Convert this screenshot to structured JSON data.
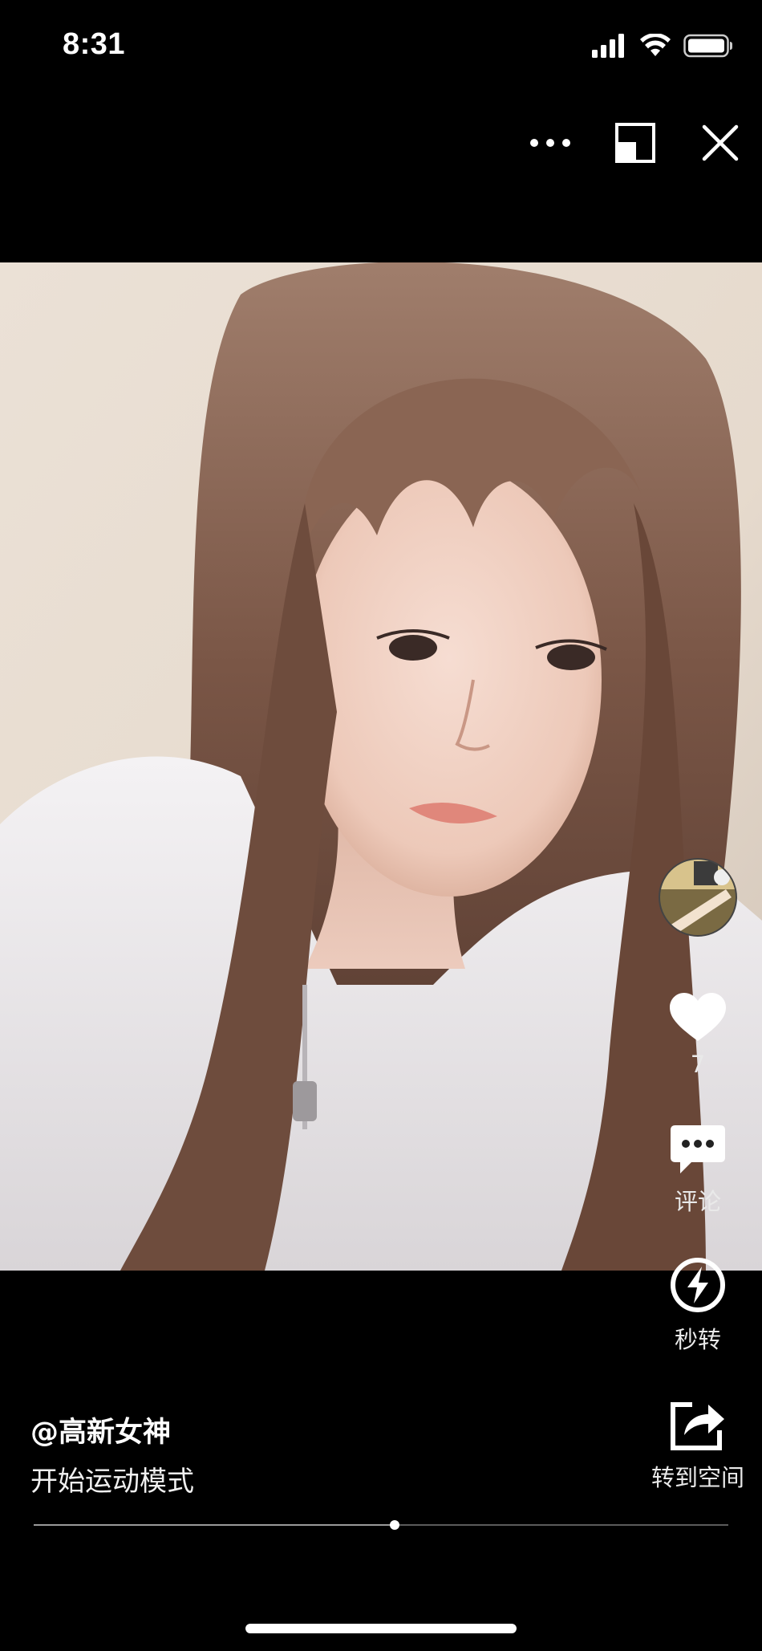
{
  "status_bar": {
    "time": "8:31",
    "icons": [
      "signal-icon",
      "wifi-icon",
      "battery-icon"
    ]
  },
  "top_bar": {
    "icons": [
      "more-icon",
      "minimize-window-icon",
      "close-icon"
    ]
  },
  "video": {
    "content": "selfie-video-frame",
    "progress_fraction": 0.52
  },
  "actions": {
    "like": {
      "icon": "heart-icon",
      "count": "7"
    },
    "comment": {
      "icon": "comment-icon",
      "label": "评论"
    },
    "quick_share": {
      "icon": "lightning-icon",
      "label": "秒转"
    },
    "share_space": {
      "icon": "share-icon",
      "label": "转到空间"
    }
  },
  "post": {
    "author": "@高新女神",
    "caption": "开始运动模式"
  },
  "colors": {
    "background": "#000000",
    "text": "#ffffff",
    "progress_track": "#5b5b5b"
  }
}
